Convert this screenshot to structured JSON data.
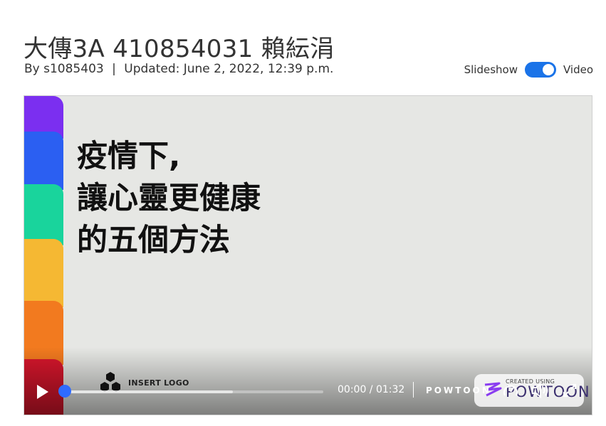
{
  "page": {
    "title": "大傳3A 410854031 賴紜涓",
    "author": "By s1085403",
    "separator": "|",
    "updated": "Updated: June 2, 2022, 12:39 p.m."
  },
  "view_toggle": {
    "left_label": "Slideshow",
    "right_label": "Video",
    "selected": "Video",
    "accent_color": "#1a73e8"
  },
  "video": {
    "slide_lines": [
      "疫情下,",
      "讓心靈更健康",
      "的五個方法"
    ],
    "stripe_colors": [
      "#7b2ff0",
      "#2b5ff2",
      "#19d49c",
      "#f5b833",
      "#f27a1f",
      "#d8162c"
    ],
    "logo_label": "INSERT LOGO",
    "badge_small": "CREATED USING",
    "badge_brand": "POWTOON",
    "player": {
      "current_time": "00:00",
      "duration": "01:32",
      "time_sep": " / ",
      "brand": "POWTOON",
      "progress_fraction": 0.0,
      "buffer_fraction": 0.65,
      "icons": [
        "play-icon",
        "speed-icon",
        "volume-icon",
        "fullscreen-icon"
      ]
    }
  }
}
